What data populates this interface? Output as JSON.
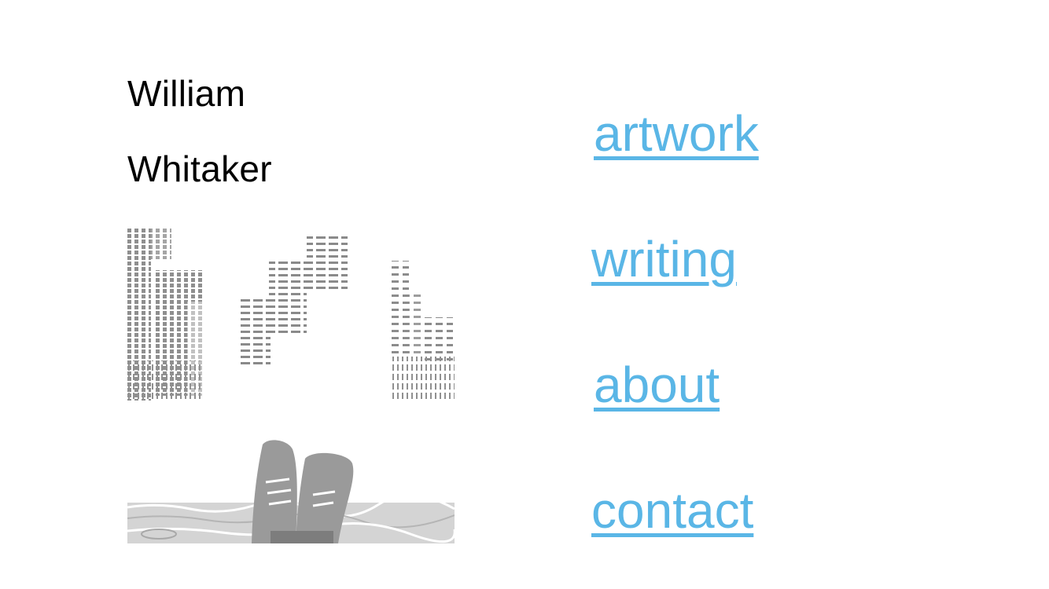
{
  "header": {
    "first_name": "William",
    "last_name": "Whitaker"
  },
  "nav": {
    "items": [
      {
        "label": "artwork"
      },
      {
        "label": "writing"
      },
      {
        "label": "about"
      },
      {
        "label": "contact"
      }
    ]
  },
  "colors": {
    "link": "#5ab6e6",
    "text": "#000000",
    "art_gray": "#999999"
  }
}
